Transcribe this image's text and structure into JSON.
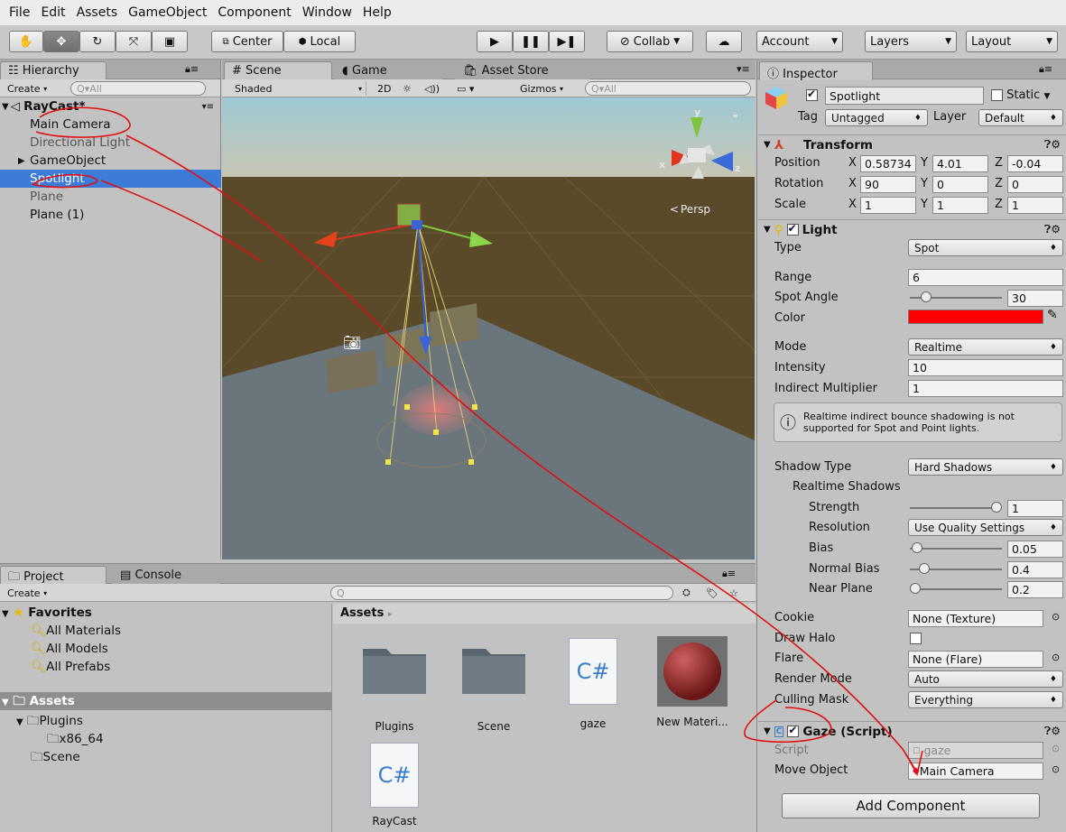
{
  "menu": [
    "File",
    "Edit",
    "Assets",
    "GameObject",
    "Component",
    "Window",
    "Help"
  ],
  "toolbar": {
    "center": "Center",
    "local": "Local",
    "collab": "Collab",
    "account": "Account",
    "layers": "Layers",
    "layout": "Layout"
  },
  "hierarchy": {
    "tab": "Hierarchy",
    "create": "Create",
    "search_placeholder": "All",
    "scene": "RayCast*",
    "items": [
      "Main Camera",
      "Directional Light",
      "GameObject",
      "Spotlight",
      "Plane",
      "Plane (1)"
    ]
  },
  "scene": {
    "tabs": [
      "Scene",
      "Game",
      "Asset Store"
    ],
    "shading": "Shaded",
    "mode2d": "2D",
    "gizmos": "Gizmos",
    "search_placeholder": "All",
    "persp": "Persp",
    "axes": {
      "x": "x",
      "y": "y",
      "z": "z"
    }
  },
  "project": {
    "tabs": [
      "Project",
      "Console"
    ],
    "create": "Create",
    "favorites": "Favorites",
    "fav_items": [
      "All Materials",
      "All Models",
      "All Prefabs"
    ],
    "assets_root": "Assets",
    "tree": [
      "Plugins",
      "x86_64",
      "Scene"
    ],
    "breadcrumb": "Assets",
    "grid": [
      "Plugins",
      "Scene",
      "gaze",
      "New Materi...",
      "RayCast"
    ],
    "cs_glyph": "C#"
  },
  "inspector": {
    "tab": "Inspector",
    "name": "Spotlight",
    "static": "Static",
    "tag_label": "Tag",
    "tag": "Untagged",
    "layer_label": "Layer",
    "layer": "Default",
    "transform": {
      "title": "Transform",
      "position": {
        "label": "Position",
        "x": "0.58734",
        "y": "4.01",
        "z": "-0.04"
      },
      "rotation": {
        "label": "Rotation",
        "x": "90",
        "y": "0",
        "z": "0"
      },
      "scale": {
        "label": "Scale",
        "x": "1",
        "y": "1",
        "z": "1"
      }
    },
    "axis": {
      "x": "X",
      "y": "Y",
      "z": "Z"
    },
    "light": {
      "title": "Light",
      "type_label": "Type",
      "type": "Spot",
      "range_label": "Range",
      "range": "6",
      "angle_label": "Spot Angle",
      "angle": "30",
      "color_label": "Color",
      "color": "#ff0000",
      "mode_label": "Mode",
      "mode": "Realtime",
      "intensity_label": "Intensity",
      "intensity": "10",
      "indirect_label": "Indirect Multiplier",
      "indirect": "1",
      "note": "Realtime indirect bounce shadowing is not supported for Spot and Point lights.",
      "shadow_type_label": "Shadow Type",
      "shadow_type": "Hard Shadows",
      "rt_shadows": "Realtime Shadows",
      "strength_label": "Strength",
      "strength": "1",
      "resolution_label": "Resolution",
      "resolution": "Use Quality Settings",
      "bias_label": "Bias",
      "bias": "0.05",
      "nbias_label": "Normal Bias",
      "nbias": "0.4",
      "near_label": "Near Plane",
      "near": "0.2",
      "cookie_label": "Cookie",
      "cookie": "None (Texture)",
      "halo_label": "Draw Halo",
      "flare_label": "Flare",
      "flare": "None (Flare)",
      "render_label": "Render Mode",
      "render": "Auto",
      "cull_label": "Culling Mask",
      "cull": "Everything"
    },
    "gaze": {
      "title": "Gaze (Script)",
      "script_label": "Script",
      "script": "gaze",
      "move_label": "Move Object",
      "move": "Main Camera"
    },
    "add_component": "Add Component"
  }
}
